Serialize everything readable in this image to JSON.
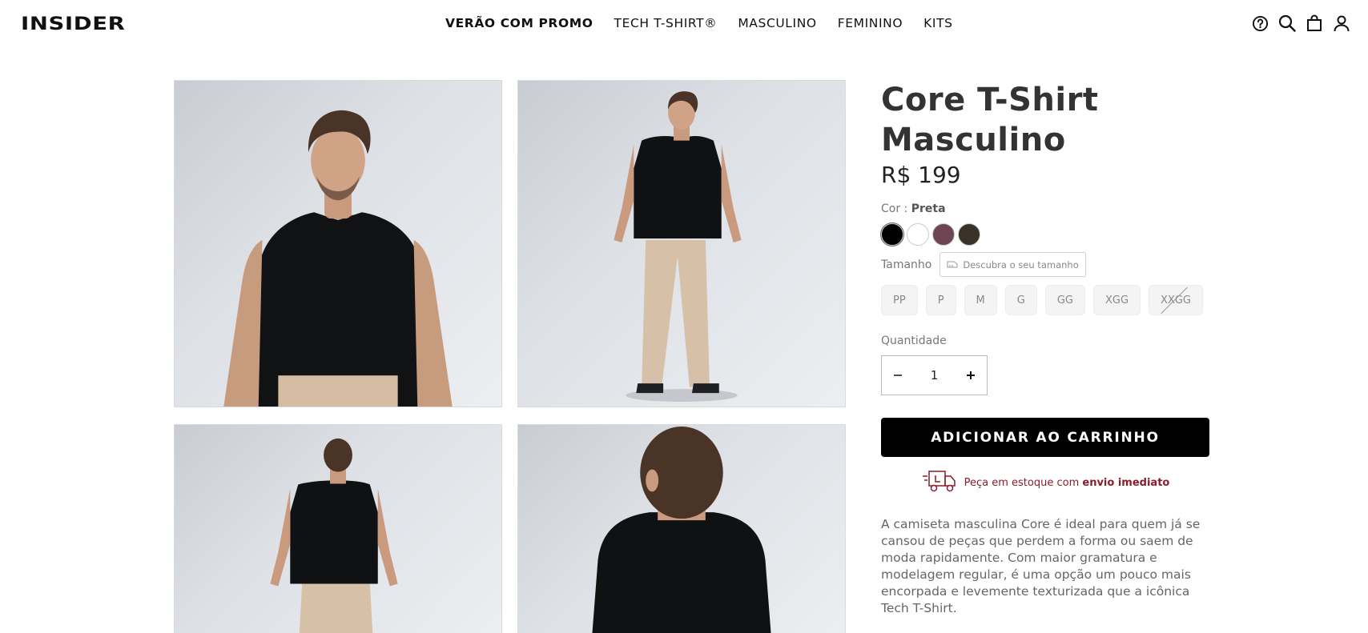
{
  "header": {
    "logo": "INSIDER",
    "nav": [
      "VERÃO COM PROMO",
      "TECH T-SHIRT®",
      "MASCULINO",
      "FEMININO",
      "KITS"
    ],
    "icons": [
      "help-icon",
      "search-icon",
      "bag-icon",
      "user-icon"
    ]
  },
  "gallery": {
    "images": [
      "front-closeup-photo",
      "front-full-body-photo",
      "back-full-body-photo",
      "back-closeup-photo"
    ]
  },
  "product": {
    "title_line1": "Core T-Shirt",
    "title_line2": "Masculino",
    "price": "R$ 199",
    "color_label": "Cor : ",
    "color_selected": "Preta",
    "swatches": [
      "#000000",
      "#ffffff",
      "#6e4553",
      "#3a3226"
    ],
    "size_label": "Tamanho",
    "size_finder_label": "Descubra o seu tamanho",
    "sizes": [
      "PP",
      "P",
      "M",
      "G",
      "GG",
      "XGG",
      "XXGG"
    ],
    "unavailable_sizes": [
      "XXGG"
    ],
    "quantity_label": "Quantidade",
    "quantity_value": "1",
    "add_to_cart_label": "ADICIONAR AO CARRINHO",
    "stock_text": "Peça em estoque com ",
    "stock_bold": "envio imediato",
    "description": "A camiseta masculina Core é ideal para quem já se cansou de peças que perdem a forma ou saem de moda rapidamente. Com maior gramatura e modelagem regular, é uma opção um pouco mais encorpada e levemente texturizada que a icônica Tech T-Shirt."
  },
  "colors": {
    "stock_red": "#8a1c2b",
    "button_black": "#000000"
  }
}
